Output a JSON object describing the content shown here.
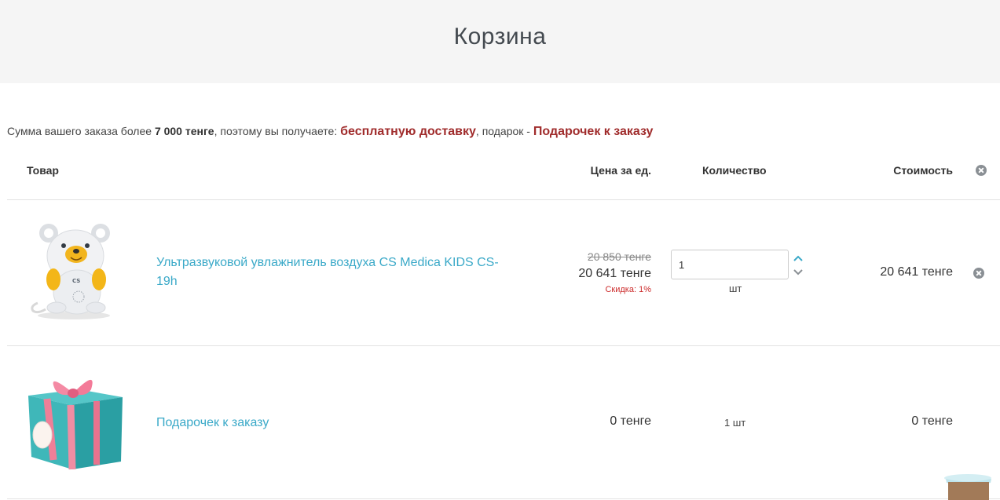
{
  "header": {
    "title": "Корзина"
  },
  "promo": {
    "prefix": "Сумма вашего заказа более ",
    "threshold": "7 000 тенге",
    "middle": ", поэтому вы получаете: ",
    "delivery": "бесплатную доставку",
    "gift_prefix": ", подарок - ",
    "gift": "Подарочек к заказу"
  },
  "table": {
    "headers": {
      "product": "Товар",
      "unit_price": "Цена за ед.",
      "quantity": "Количество",
      "total": "Стоимость"
    },
    "items": [
      {
        "name": "Ультразвуковой увлажнитель воздуха CS Medica KIDS CS-19h",
        "image_icon": "bear-humidifier-image",
        "old_price": "20 850 тенге",
        "price": "20 641 тенге",
        "discount": "Скидка: 1%",
        "quantity": "1",
        "unit": "шт",
        "total": "20 641 тенге"
      },
      {
        "name": "Подарочек к заказу",
        "image_icon": "gift-box-image",
        "price": "0 тенге",
        "quantity_text": "1 шт",
        "total": "0 тенге"
      }
    ]
  },
  "icons": {
    "remove": "remove-icon",
    "qty_up": "chevron-up-icon",
    "qty_down": "chevron-down-icon"
  },
  "colors": {
    "link": "#3aa9c8",
    "accent": "#a02c2c",
    "discount": "#cc2a2a",
    "header_bg": "#f5f5f5"
  }
}
